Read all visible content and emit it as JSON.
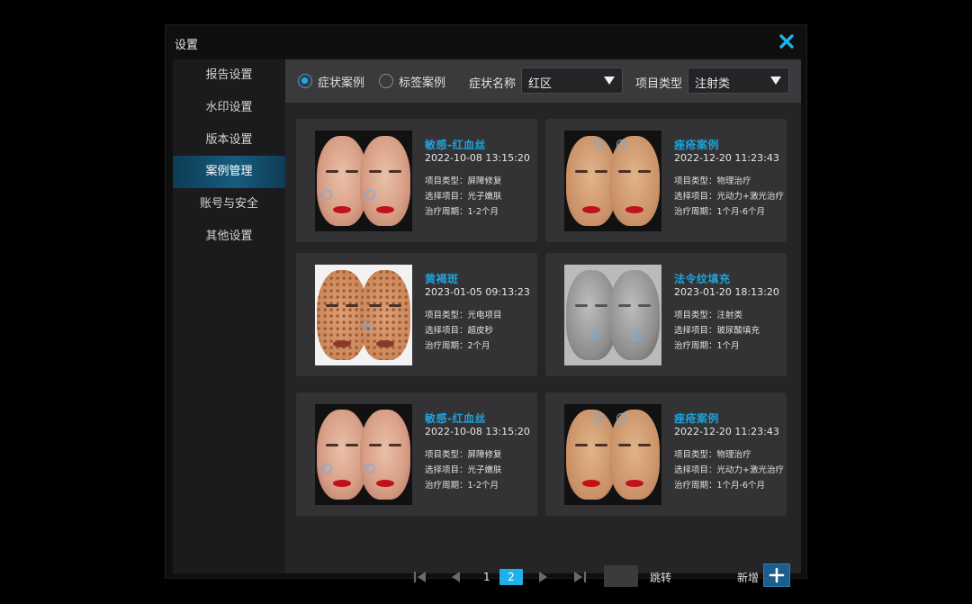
{
  "window": {
    "title": "设置",
    "close_icon": "close-icon",
    "accent": "#1fa0d8"
  },
  "sidebar": {
    "items": [
      {
        "label": "报告设置",
        "active": false
      },
      {
        "label": "水印设置",
        "active": false
      },
      {
        "label": "版本设置",
        "active": false
      },
      {
        "label": "案例管理",
        "active": true
      },
      {
        "label": "账号与安全",
        "active": false
      },
      {
        "label": "其他设置",
        "active": false
      }
    ]
  },
  "filters": {
    "radio_symptom": "症状案例",
    "radio_tag": "标签案例",
    "selected_radio": "症状案例",
    "symptom_label": "症状名称",
    "symptom_value": "红区",
    "type_label": "项目类型",
    "type_value": "注射类"
  },
  "cards": [
    {
      "title": "敏感-红血丝",
      "date": "2022-10-08  13:15:20",
      "line1": "项目类型：屏障修复",
      "line2": "选择项目：光子嫩肤",
      "line3": "治疗周期：1-2个月"
    },
    {
      "title": "痤疮案例",
      "date": "2022-12-20  11:23:43",
      "line1": "项目类型：物理治疗",
      "line2": "选择项目：光动力+激光治疗",
      "line3": "治疗周期：1个月-6个月"
    },
    {
      "title": "黄褐斑",
      "date": "2023-01-05  09:13:23",
      "line1": "项目类型：光电项目",
      "line2": "选择项目：超皮秒",
      "line3": "治疗周期：2个月"
    },
    {
      "title": "法令纹填充",
      "date": "2023-01-20  18:13:20",
      "line1": "项目类型：注射类",
      "line2": "选择项目：玻尿酸填充",
      "line3": "治疗周期：1个月"
    },
    {
      "title": "敏感-红血丝",
      "date": "2022-10-08  13:15:20",
      "line1": "项目类型：屏障修复",
      "line2": "选择项目：光子嫩肤",
      "line3": "治疗周期：1-2个月"
    },
    {
      "title": "痤疮案例",
      "date": "2022-12-20  11:23:43",
      "line1": "项目类型：物理治疗",
      "line2": "选择项目：光动力+激光治疗",
      "line3": "治疗周期：1个月-6个月"
    }
  ],
  "pagination": {
    "page1": "1",
    "page2": "2",
    "current": "2",
    "jump_label": "跳转",
    "jump_value": ""
  },
  "add": {
    "label": "新增"
  }
}
